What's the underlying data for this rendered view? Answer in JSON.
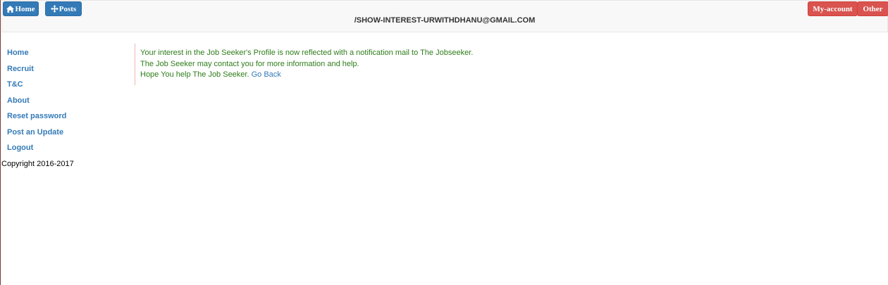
{
  "toolbar": {
    "home_label": "Home",
    "posts_label": "Posts",
    "account_label": "My-account",
    "other_label": "Other"
  },
  "header": {
    "title": "/SHOW-INTEREST-URWITHDHANU@GMAIL.COM"
  },
  "sidebar": {
    "items": [
      {
        "label": "Home"
      },
      {
        "label": "Recruit"
      },
      {
        "label": "T&C"
      },
      {
        "label": "About"
      },
      {
        "label": "Reset password"
      },
      {
        "label": "Post an Update"
      },
      {
        "label": "Logout"
      }
    ],
    "copyright": "Copyright 2016-2017"
  },
  "main": {
    "line1": "Your interest in the Job Seeker's Profile is now reflected with a notification mail to The Jobseeker.",
    "line2": "The Job Seeker may contact you for more information and help.",
    "line3": "Hope You help The Job Seeker.",
    "go_back_label": "Go Back"
  },
  "icons": {
    "home": "home-icon",
    "posts": "move-arrows-icon"
  },
  "colors": {
    "primary_button": "#337ab7",
    "danger_button": "#d9534f",
    "link": "#337ab7",
    "success_text": "#2e7d1a"
  }
}
